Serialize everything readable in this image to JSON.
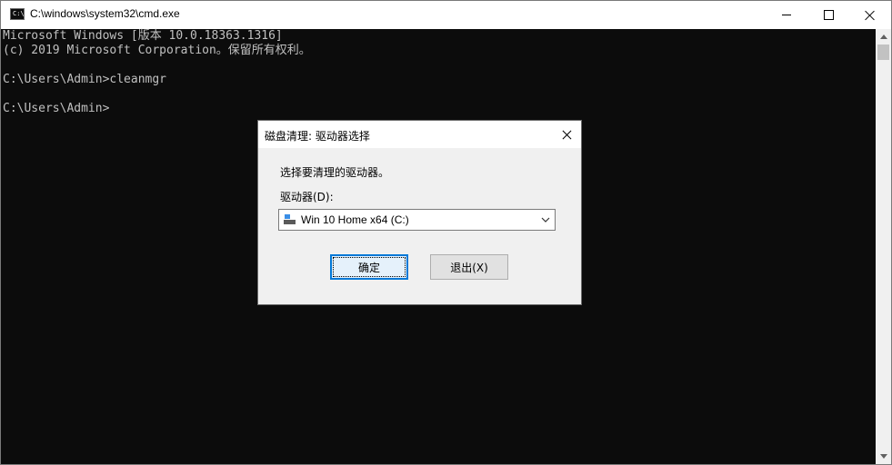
{
  "window": {
    "title": "C:\\windows\\system32\\cmd.exe",
    "app_icon_text": "C:\\"
  },
  "console": {
    "lines": [
      "Microsoft Windows [版本 10.0.18363.1316]",
      "(c) 2019 Microsoft Corporation。保留所有权利。",
      "",
      "C:\\Users\\Admin>cleanmgr",
      "",
      "C:\\Users\\Admin>"
    ]
  },
  "dialog": {
    "title": "磁盘清理: 驱动器选择",
    "prompt": "选择要清理的驱动器。",
    "drive_label": "驱动器(D):",
    "drive_selected": "Win 10 Home x64 (C:)",
    "ok_label": "确定",
    "exit_label": "退出(X)"
  },
  "colors": {
    "console_bg": "#0c0c0c",
    "console_text": "#c0c0c0",
    "dialog_bg": "#f0f0f0",
    "accent": "#0078d7"
  },
  "icons": [
    "cmd-app-icon",
    "minimize-icon",
    "maximize-icon",
    "close-icon",
    "drive-icon",
    "chevron-down-icon"
  ]
}
